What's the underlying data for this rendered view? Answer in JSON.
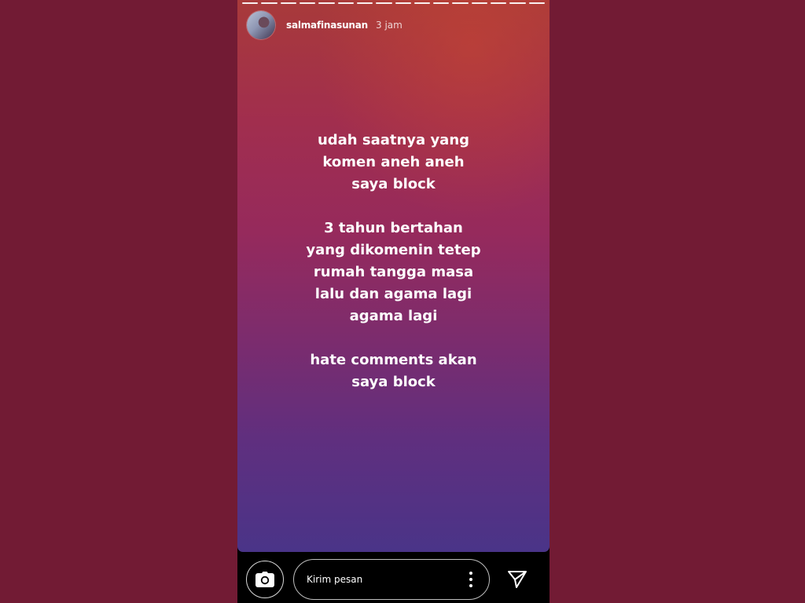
{
  "story": {
    "username": "salmafinasunan",
    "time_ago": "3 jam",
    "progress_segments": 16,
    "text_paragraphs": [
      [
        "udah saatnya yang",
        "komen aneh aneh",
        "saya block"
      ],
      [
        "3 tahun bertahan",
        "yang dikomenin tetep",
        "rumah tangga masa",
        "lalu dan agama lagi",
        "agama lagi"
      ],
      [
        "hate comments akan",
        "saya block"
      ]
    ]
  },
  "footer": {
    "message_placeholder": "Kirim pesan",
    "camera_icon": "camera-icon",
    "more_icon": "more-vertical-icon",
    "send_icon": "send-icon"
  },
  "colors": {
    "page_background": "#721b34",
    "gradient_top": "#a83a3a",
    "gradient_bottom": "#4a3488"
  }
}
